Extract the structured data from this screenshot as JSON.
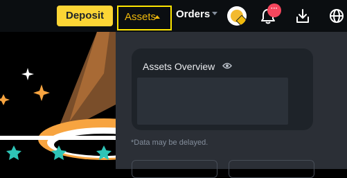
{
  "header": {
    "deposit_label": "Deposit",
    "assets_label": "Assets",
    "orders_label": "Orders",
    "notification_badge": "···",
    "icons": [
      "avatar",
      "bell-icon",
      "download-icon",
      "globe-icon"
    ]
  },
  "assets_dropdown": {
    "overview_title": "Assets Overview",
    "delay_note": "*Data may be delayed."
  },
  "colors": {
    "accent": "#fcd535",
    "highlight_border": "#ffe600",
    "assets_text": "#f0b90b",
    "badge": "#f6465d",
    "panel": "#2b2f36",
    "card": "#1e2329",
    "star": "#2ec4b6",
    "sparkle_orange": "#f7a440"
  }
}
